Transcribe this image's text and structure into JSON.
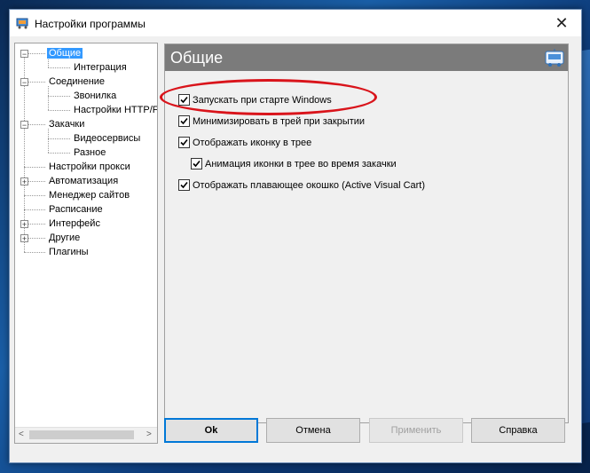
{
  "window": {
    "title": "Настройки программы",
    "close_symbol": "✕"
  },
  "tree": {
    "items": [
      {
        "label": "Общие",
        "level": 0,
        "expander": "−",
        "selected": true
      },
      {
        "label": "Интеграция",
        "level": 1
      },
      {
        "label": "Соединение",
        "level": 0,
        "expander": "−"
      },
      {
        "label": "Звонилка",
        "level": 1
      },
      {
        "label": "Настройки HTTP/FTP",
        "level": 1
      },
      {
        "label": "Закачки",
        "level": 0,
        "expander": "−"
      },
      {
        "label": "Видеосервисы",
        "level": 1
      },
      {
        "label": "Разное",
        "level": 1
      },
      {
        "label": "Настройки прокси",
        "level": 0
      },
      {
        "label": "Автоматизация",
        "level": 0,
        "expander": "+"
      },
      {
        "label": "Менеджер сайтов",
        "level": 0
      },
      {
        "label": "Расписание",
        "level": 0
      },
      {
        "label": "Интерфейс",
        "level": 0,
        "expander": "+"
      },
      {
        "label": "Другие",
        "level": 0,
        "expander": "+"
      },
      {
        "label": "Плагины",
        "level": 0
      }
    ],
    "scroll_left": "<",
    "scroll_right": ">"
  },
  "panel": {
    "title": "Общие",
    "header_icon": "cart-icon"
  },
  "options": [
    {
      "label": "Запускать при старте Windows",
      "checked": true,
      "indent": 0
    },
    {
      "label": "Минимизировать в трей при закрытии",
      "checked": true,
      "indent": 0
    },
    {
      "label": "Отображать иконку в трее",
      "checked": true,
      "indent": 0
    },
    {
      "label": "Анимация иконки в трее во время закачки",
      "checked": true,
      "indent": 1
    },
    {
      "label": "Отображать плавающее окошко (Active Visual Cart)",
      "checked": true,
      "indent": 0
    }
  ],
  "buttons": {
    "ok": "Ok",
    "cancel": "Отмена",
    "apply": "Применить",
    "help": "Справка"
  },
  "colors": {
    "selection": "#3399ff",
    "header": "#7b7b7b",
    "highlight": "#d9141b",
    "default_button_border": "#0078d7"
  }
}
